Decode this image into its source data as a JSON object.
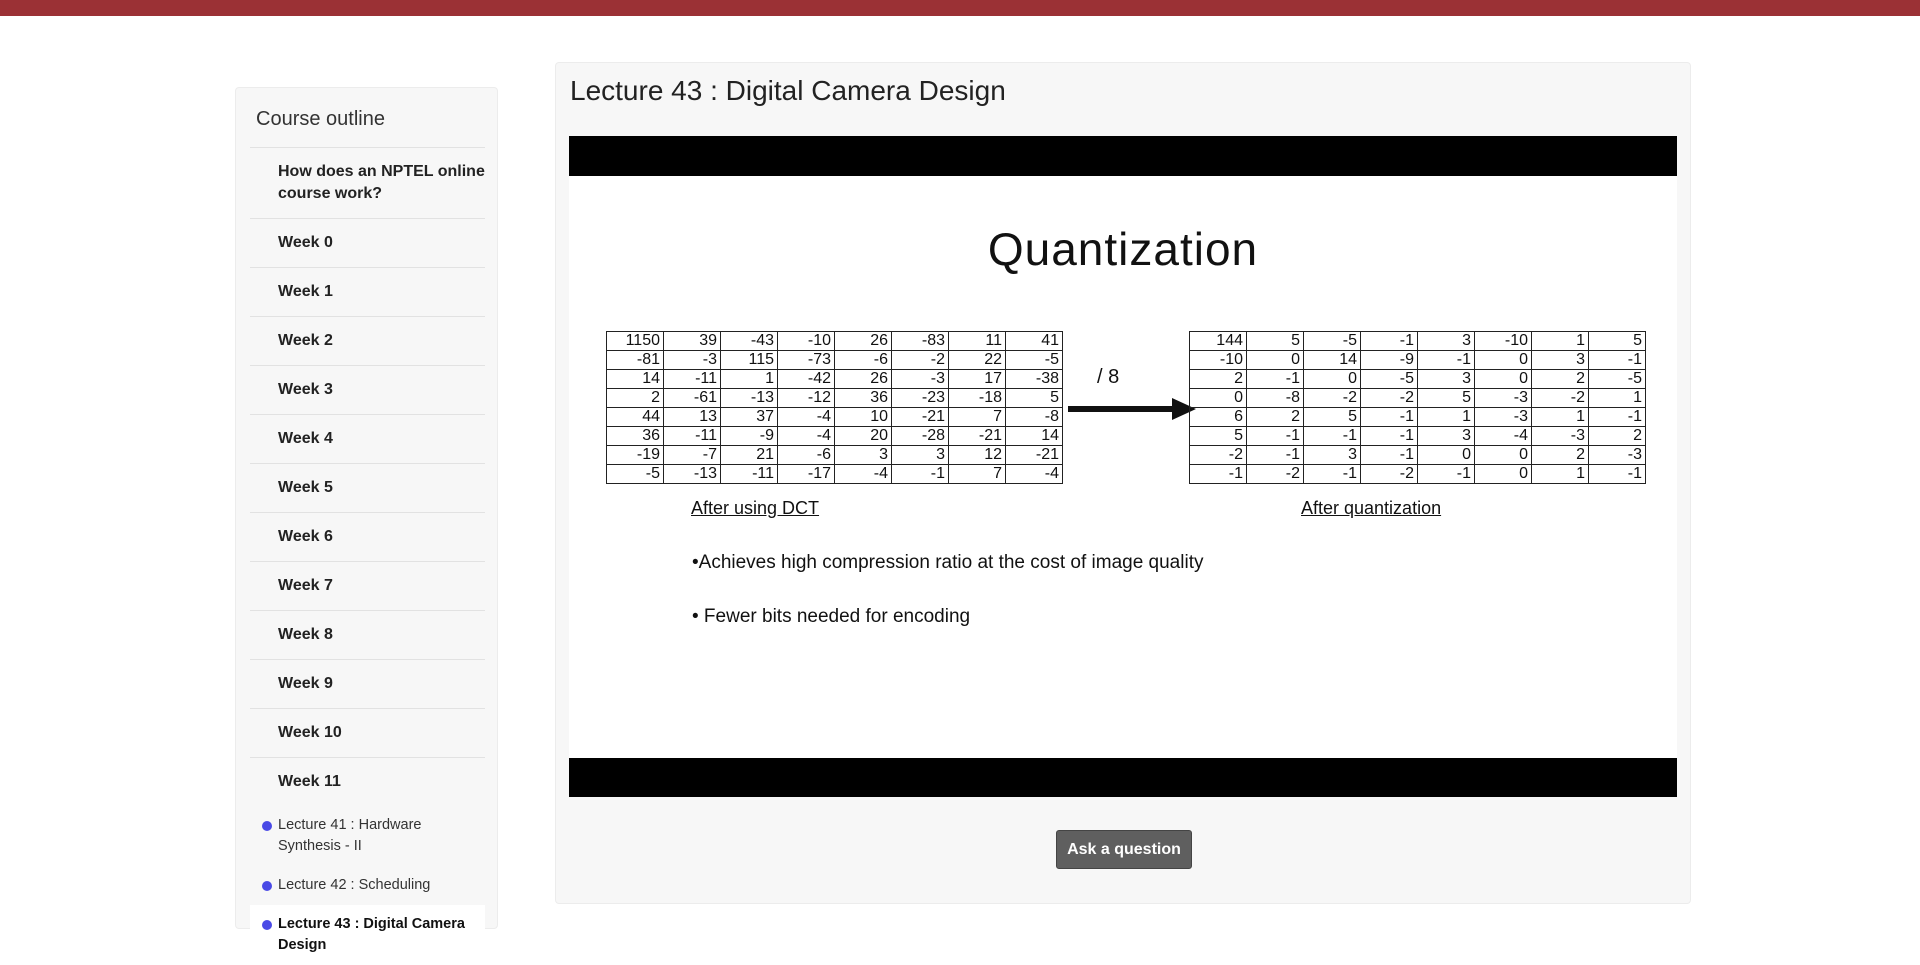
{
  "colors": {
    "topbar": "#9b3135",
    "dot": "#4a4ae6",
    "button": "#5f5f5f"
  },
  "sidebar": {
    "title": "Course outline",
    "items": [
      "How does an NPTEL online course work?",
      "Week 0",
      "Week 1",
      "Week 2",
      "Week 3",
      "Week 4",
      "Week 5",
      "Week 6",
      "Week 7",
      "Week 8",
      "Week 9",
      "Week 10",
      "Week 11"
    ],
    "sub_items": [
      {
        "label": "Lecture 41 : Hardware Synthesis - II",
        "active": false
      },
      {
        "label": "Lecture 42 : Scheduling",
        "active": false
      },
      {
        "label": "Lecture 43 : Digital Camera Design",
        "active": true
      }
    ]
  },
  "main": {
    "lecture_title": "Lecture 43 : Digital Camera Design",
    "ask_button": "Ask a question"
  },
  "slide": {
    "title": "Quantization",
    "divide_label": "/ 8",
    "left_caption": "After using DCT",
    "right_caption": "After quantization",
    "bullets": [
      "•Achieves  high compression ratio at the cost of image quality",
      "• Fewer bits needed for encoding"
    ],
    "dct_matrix": [
      [
        "1150",
        "39",
        "-43",
        "-10",
        "26",
        "-83",
        "11",
        "41"
      ],
      [
        "-81",
        "-3",
        "115",
        "-73",
        "-6",
        "-2",
        "22",
        "-5"
      ],
      [
        "14",
        "-11",
        "1",
        "-42",
        "26",
        "-3",
        "17",
        "-38"
      ],
      [
        "2",
        "-61",
        "-13",
        "-12",
        "36",
        "-23",
        "-18",
        "5"
      ],
      [
        "44",
        "13",
        "37",
        "-4",
        "10",
        "-21",
        "7",
        "-8"
      ],
      [
        "36",
        "-11",
        "-9",
        "-4",
        "20",
        "-28",
        "-21",
        "14"
      ],
      [
        "-19",
        "-7",
        "21",
        "-6",
        "3",
        "3",
        "12",
        "-21"
      ],
      [
        "-5",
        "-13",
        "-11",
        "-17",
        "-4",
        "-1",
        "7",
        "-4"
      ]
    ],
    "quant_matrix": [
      [
        "144",
        "5",
        "-5",
        "-1",
        "3",
        "-10",
        "1",
        "5"
      ],
      [
        "-10",
        "0",
        "14",
        "-9",
        "-1",
        "0",
        "3",
        "-1"
      ],
      [
        "2",
        "-1",
        "0",
        "-5",
        "3",
        "0",
        "2",
        "-5"
      ],
      [
        "0",
        "-8",
        "-2",
        "-2",
        "5",
        "-3",
        "-2",
        "1"
      ],
      [
        "6",
        "2",
        "5",
        "-1",
        "1",
        "-3",
        "1",
        "-1"
      ],
      [
        "5",
        "-1",
        "-1",
        "-1",
        "3",
        "-4",
        "-3",
        "2"
      ],
      [
        "-2",
        "-1",
        "3",
        "-1",
        "0",
        "0",
        "2",
        "-3"
      ],
      [
        "-1",
        "-2",
        "-1",
        "-2",
        "-1",
        "0",
        "1",
        "-1"
      ]
    ]
  }
}
